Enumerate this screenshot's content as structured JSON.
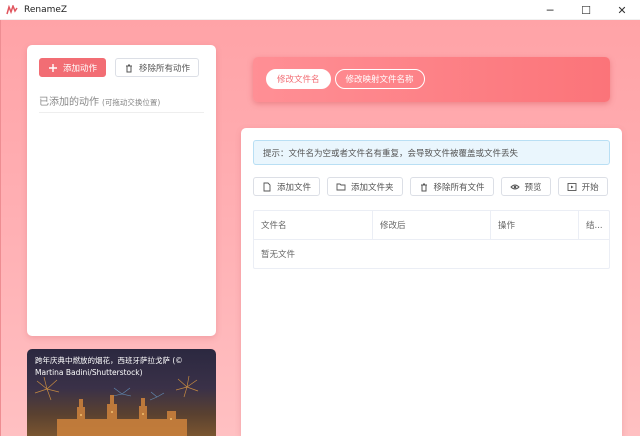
{
  "window": {
    "title": "RenameZ",
    "minimize": "─",
    "maximize": "☐",
    "close": "✕"
  },
  "left_panel": {
    "add_action": "添加动作",
    "remove_all_actions": "移除所有动作",
    "added_actions_label": "已添加的动作",
    "drag_hint": "(可拖动交换位置)"
  },
  "photo": {
    "caption": "跨年庆典中燃放的烟花，西班牙萨拉戈萨 (© Martina Badini/Shutterstock)"
  },
  "mode_tabs": [
    {
      "label": "修改文件名",
      "active": true
    },
    {
      "label": "修改映射文件名称",
      "active": false
    }
  ],
  "main": {
    "notice": "提示：文件名为空或者文件名有重复，会导致文件被覆盖或文件丢失",
    "toolbar": {
      "add_file": "添加文件",
      "add_folder": "添加文件夹",
      "remove_all_files": "移除所有文件",
      "preview": "预览",
      "start": "开始"
    },
    "table": {
      "columns": [
        "文件名",
        "修改后",
        "操作",
        "结..."
      ],
      "empty_text": "暂无文件"
    }
  },
  "colors": {
    "accent": "#f26d74",
    "background": "#ffb0b4",
    "notice_bg": "#eaf6fd"
  }
}
